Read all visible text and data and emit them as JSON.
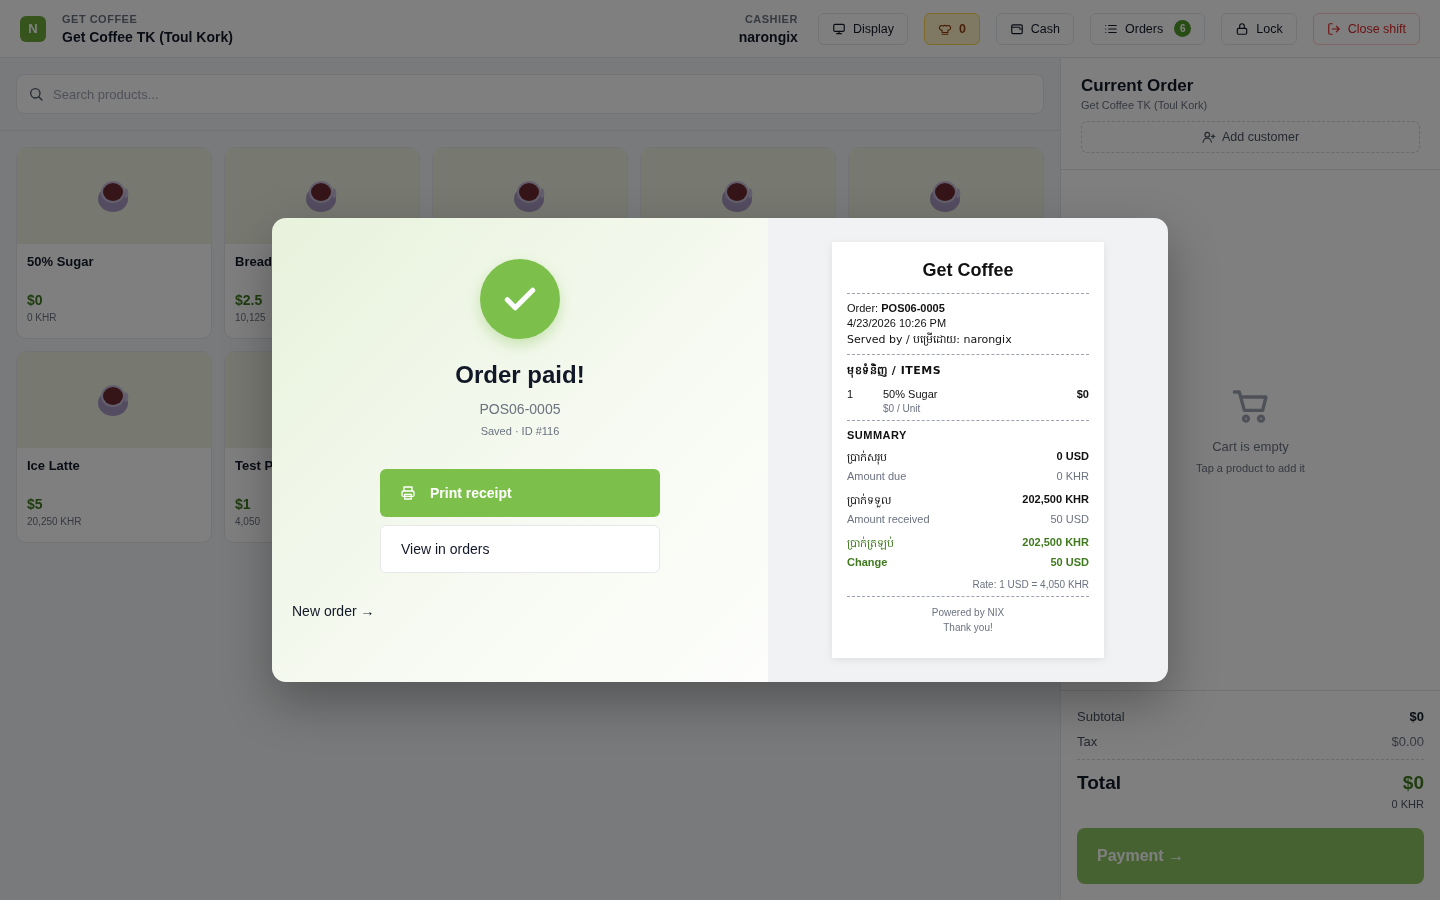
{
  "header": {
    "logo_letter": "N",
    "store_label": "GET COFFEE",
    "store_name": "Get Coffee TK (Toul Kork)",
    "cashier_label": "CASHIER",
    "cashier_name": "narongix",
    "buttons": [
      {
        "kind": "display",
        "label": "Display"
      },
      {
        "kind": "kitchen",
        "label": "0"
      },
      {
        "kind": "cash",
        "label": "Cash"
      },
      {
        "kind": "orders",
        "label": "Orders",
        "badge": "6"
      },
      {
        "kind": "lock",
        "label": "Lock"
      },
      {
        "kind": "close",
        "label": "Close shift"
      }
    ]
  },
  "search": {
    "placeholder": "Search products..."
  },
  "products": [
    {
      "kind": "full",
      "name": "50% Sugar",
      "price": "$0",
      "price_khr": "0 KHR"
    },
    {
      "kind": "full",
      "name": "Bread",
      "price": "$2.5",
      "price_khr": "10,125"
    },
    {
      "kind": "covered"
    },
    {
      "kind": "covered"
    },
    {
      "kind": "covered"
    },
    {
      "kind": "full",
      "name": "Ice Latte",
      "price": "$5",
      "price_khr": "20,250 KHR"
    },
    {
      "kind": "full",
      "name": "Test P",
      "price": "$1",
      "price_khr": "4,050"
    }
  ],
  "order_panel": {
    "title": "Current Order",
    "subtitle": "Get Coffee TK (Toul Kork)",
    "add_customer": "Add customer",
    "empty_title": "Cart is empty",
    "empty_hint": "Tap a product to add it",
    "totals": [
      {
        "label": "Subtotal",
        "value": "$0",
        "kind": "strong"
      },
      {
        "label": "Tax",
        "value": "$0.00",
        "kind": "muted"
      }
    ],
    "total_label": "Total",
    "total_value": "$0",
    "total_khr": "0 KHR",
    "payment_button": {
      "label": "Payment →",
      "disabled": true
    }
  },
  "modal": {
    "title": "Order paid!",
    "order_number": "POS06-0005",
    "saved": "Saved · ID #116",
    "print_button": "Print receipt",
    "view_button": "View in orders",
    "new_order": "New order →",
    "receipt": {
      "shop": "Get Coffee",
      "order": "Order: **POS06-0005**",
      "datetime": "4/23/2026 10:26 PM",
      "served_by": "Served by / បម្រើដោយ: narongix",
      "items_heading": "មុខទំនិញ / ITEMS",
      "items": [
        {
          "qty": "1",
          "name": "50% Sugar",
          "unit": "$0 / Unit",
          "amount": "$0"
        }
      ],
      "summary_heading": "SUMMARY",
      "summary": [
        {
          "kind": "normal",
          "label_km": "ប្រាក់សរុប",
          "label_en": "Amount due",
          "value": "0 USD",
          "value_sub": "0 KHR"
        },
        {
          "kind": "normal",
          "label_km": "ប្រាក់ទទួល",
          "label_en": "Amount received",
          "value": "202,500 KHR",
          "value_sub": "50 USD"
        },
        {
          "kind": "change",
          "label_km": "ប្រាក់ត្រឡប់",
          "label_en": "Change",
          "value": "202,500 KHR",
          "value_sub": "50 USD"
        }
      ],
      "rate": "Rate: 1 USD = 4,050 KHR",
      "powered": "Powered by NIX",
      "thanks": "Thank you!"
    }
  }
}
